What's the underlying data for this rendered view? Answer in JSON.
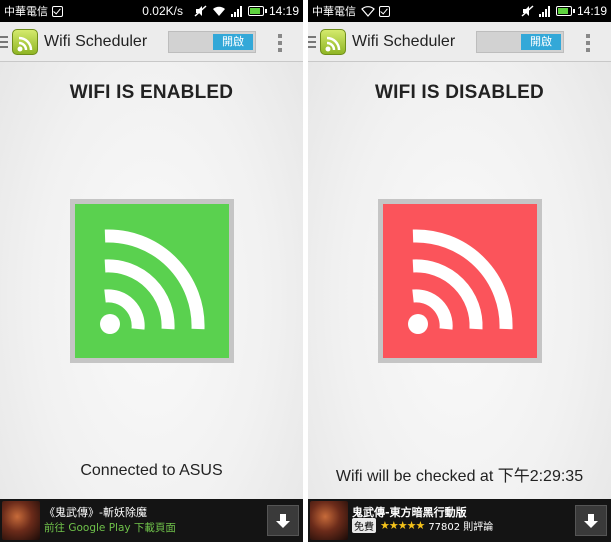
{
  "left_screen": {
    "status_bar": {
      "carrier": "中華電信",
      "speed": "0.02K/s",
      "time": "14:19"
    },
    "action_bar": {
      "app_title": "Wifi Scheduler",
      "toggle_label": "開啟",
      "toggle_on": true
    },
    "status_title": "WIFI IS ENABLED",
    "wifi_state": "enabled",
    "tile_color": "#5ad14f",
    "status_message": "Connected to ASUS",
    "ad": {
      "title": "《鬼武傳》-斬妖除魔",
      "subtitle": "前往 Google Play 下載頁面"
    }
  },
  "right_screen": {
    "status_bar": {
      "carrier": "中華電信",
      "time": "14:19"
    },
    "action_bar": {
      "app_title": "Wifi Scheduler",
      "toggle_label": "開啟",
      "toggle_on": true
    },
    "status_title": "WIFI IS DISABLED",
    "wifi_state": "disabled",
    "tile_color": "#fb545b",
    "status_message": "Wifi will be checked at 下午2:29:35",
    "ad": {
      "title": "鬼武傳-東方暗黑行動版",
      "badge": "免費",
      "stars": "★★★★★",
      "rating_count": "77802 則評論"
    }
  },
  "colors": {
    "accent": "#33a8d8",
    "enabled": "#5ad14f",
    "disabled": "#fb545b"
  },
  "icons": [
    "drawer-icon",
    "wifi-app-icon",
    "overflow-menu-icon",
    "wifi-signal-icon",
    "download-icon",
    "signal-bars-icon",
    "battery-icon",
    "mute-icon",
    "check-icon"
  ]
}
